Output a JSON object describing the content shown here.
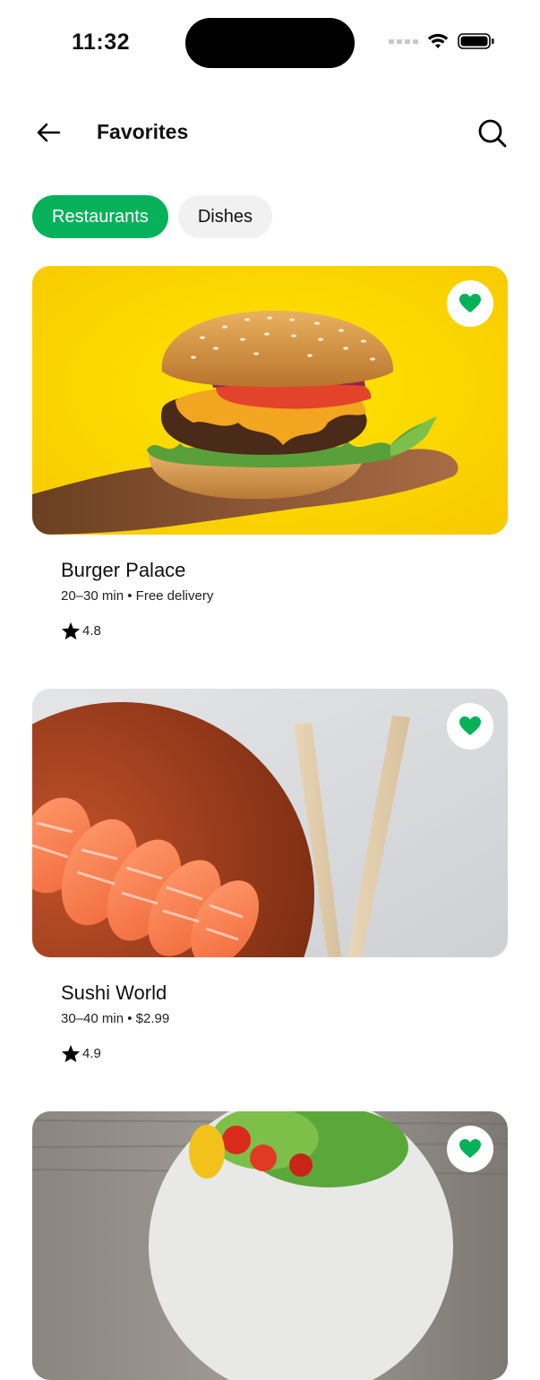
{
  "status_bar": {
    "time": "11:32"
  },
  "header": {
    "title": "Favorites"
  },
  "tabs": [
    {
      "label": "Restaurants",
      "active": true
    },
    {
      "label": "Dishes",
      "active": false
    }
  ],
  "restaurants": [
    {
      "name": "Burger Palace",
      "time": "20–30 min",
      "delivery": "Free delivery",
      "rating": "4.8",
      "favorite": true
    },
    {
      "name": "Sushi World",
      "time": "30–40 min",
      "delivery": "$2.99",
      "rating": "4.9",
      "favorite": true
    },
    {
      "favorite": true
    }
  ],
  "colors": {
    "accent": "#06b15a",
    "inactive_tab": "#f1f1f1"
  },
  "icons": {
    "back": "arrow-left-icon",
    "search": "search-icon",
    "favorite": "heart-icon",
    "rating": "star-icon"
  }
}
